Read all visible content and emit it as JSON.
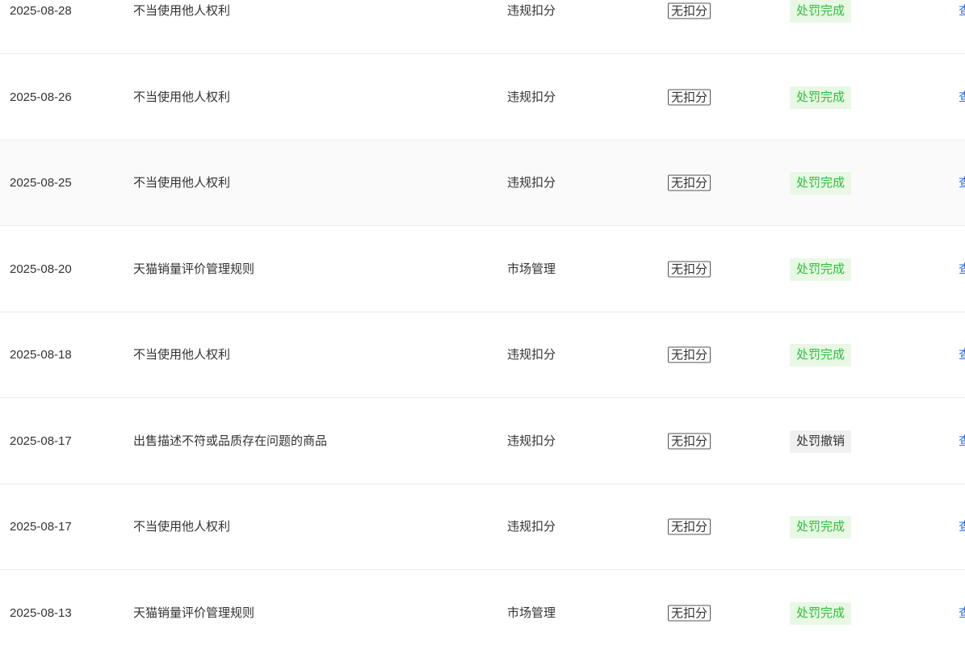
{
  "rows": [
    {
      "date": "2025-08-28",
      "reason": "不当使用他人权利",
      "type": "违规扣分",
      "points": "无扣分",
      "status": "处罚完成",
      "status_kind": "done",
      "action": "查"
    },
    {
      "date": "2025-08-26",
      "reason": "不当使用他人权利",
      "type": "违规扣分",
      "points": "无扣分",
      "status": "处罚完成",
      "status_kind": "done",
      "action": "查"
    },
    {
      "date": "2025-08-25",
      "reason": "不当使用他人权利",
      "type": "违规扣分",
      "points": "无扣分",
      "status": "处罚完成",
      "status_kind": "done",
      "action": "查"
    },
    {
      "date": "2025-08-20",
      "reason": "天猫销量评价管理规则",
      "type": "市场管理",
      "points": "无扣分",
      "status": "处罚完成",
      "status_kind": "done",
      "action": "查"
    },
    {
      "date": "2025-08-18",
      "reason": "不当使用他人权利",
      "type": "违规扣分",
      "points": "无扣分",
      "status": "处罚完成",
      "status_kind": "done",
      "action": "查"
    },
    {
      "date": "2025-08-17",
      "reason": "出售描述不符或品质存在问题的商品",
      "type": "违规扣分",
      "points": "无扣分",
      "status": "处罚撤销",
      "status_kind": "revoked",
      "action": "查"
    },
    {
      "date": "2025-08-17",
      "reason": "不当使用他人权利",
      "type": "违规扣分",
      "points": "无扣分",
      "status": "处罚完成",
      "status_kind": "done",
      "action": "查"
    },
    {
      "date": "2025-08-13",
      "reason": "天猫销量评价管理规则",
      "type": "市场管理",
      "points": "无扣分",
      "status": "处罚完成",
      "status_kind": "done",
      "action": "查"
    }
  ],
  "colors": {
    "status_done_text": "#2fbf3b",
    "status_done_bg": "#e8f8e4",
    "status_revoked_bg": "#f0f0f0",
    "link": "#2f6fe4"
  }
}
